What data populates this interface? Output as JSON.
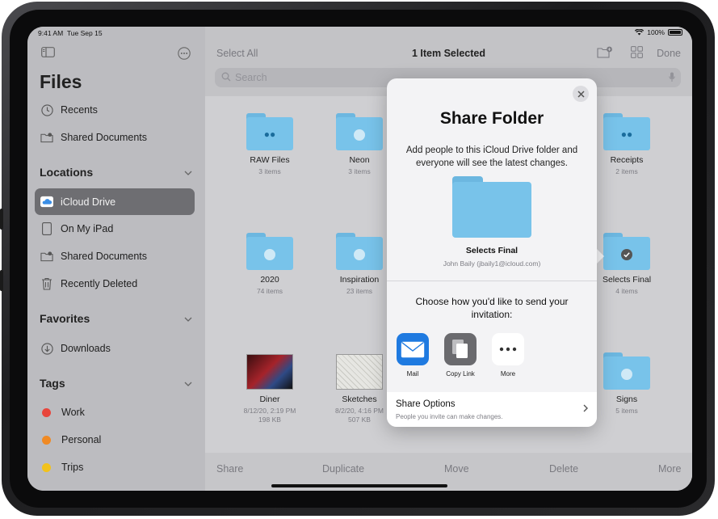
{
  "status": {
    "time": "9:41 AM",
    "date": "Tue Sep 15",
    "battery": "100%"
  },
  "sidebar": {
    "title": "Files",
    "top_items": [
      {
        "label": "Recents",
        "icon": "clock-icon"
      },
      {
        "label": "Shared Documents",
        "icon": "shared-folder-icon"
      }
    ],
    "locations_header": "Locations",
    "locations": [
      {
        "label": "iCloud Drive",
        "icon": "icloud-icon",
        "selected": true
      },
      {
        "label": "On My iPad",
        "icon": "ipad-icon"
      },
      {
        "label": "Shared Documents",
        "icon": "shared-folder-icon"
      },
      {
        "label": "Recently Deleted",
        "icon": "trash-icon"
      }
    ],
    "favorites_header": "Favorites",
    "favorites": [
      {
        "label": "Downloads",
        "icon": "download-icon"
      }
    ],
    "tags_header": "Tags",
    "tags": [
      {
        "label": "Work",
        "color": "#e8453c"
      },
      {
        "label": "Personal",
        "color": "#f08a24"
      },
      {
        "label": "Trips",
        "color": "#f2c21b"
      }
    ]
  },
  "header": {
    "select_all": "Select All",
    "title": "1 Item Selected",
    "done": "Done"
  },
  "search": {
    "placeholder": "Search"
  },
  "files": [
    {
      "name": "RAW Files",
      "sub": "3 items"
    },
    {
      "name": "Neon",
      "sub": "3 items"
    },
    {
      "name": "Receipts",
      "sub": "2 items"
    },
    {
      "name": "2020",
      "sub": "74 items"
    },
    {
      "name": "Inspiration",
      "sub": "23 items"
    },
    {
      "name": "Selects Final",
      "sub": "4 items"
    },
    {
      "name": "Diner",
      "sub": "8/12/20, 2:19 PM",
      "sub2": "198 KB"
    },
    {
      "name": "Sketches",
      "sub": "8/2/20, 4:16 PM",
      "sub2": "507 KB"
    },
    {
      "name": "Signs",
      "sub": "5 items"
    }
  ],
  "toolbar": {
    "share": "Share",
    "duplicate": "Duplicate",
    "move": "Move",
    "delete": "Delete",
    "more": "More"
  },
  "popover": {
    "title": "Share Folder",
    "description": "Add people to this iCloud Drive folder and everyone will see the latest changes.",
    "folder_name": "Selects Final",
    "owner": "John Baily (jbaily1@icloud.com)",
    "choose": "Choose how you'd like to send your invitation:",
    "apps": [
      {
        "label": "Mail",
        "icon": "mail-icon"
      },
      {
        "label": "Copy Link",
        "icon": "copy-link-icon"
      },
      {
        "label": "More",
        "icon": "more-icon"
      }
    ],
    "share_options_title": "Share Options",
    "share_options_sub": "People you invite can make changes."
  },
  "colors": {
    "folder": "#78c3ea",
    "mail_blue": "#1f7ae0",
    "selected_row": "#6e6e72"
  }
}
